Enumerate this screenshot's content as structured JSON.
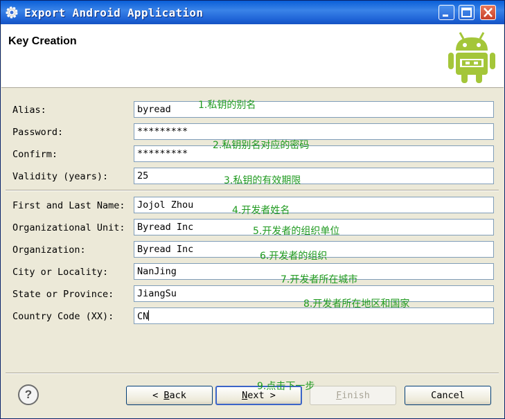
{
  "window": {
    "title": "Export Android Application"
  },
  "header": {
    "title": "Key Creation"
  },
  "form": {
    "alias": {
      "label": "Alias:",
      "value": "byread"
    },
    "password": {
      "label": "Password:",
      "value": "*********"
    },
    "confirm": {
      "label": "Confirm:",
      "value": "*********"
    },
    "validity": {
      "label": "Validity (years):",
      "value": "25"
    },
    "name": {
      "label": "First and Last Name:",
      "value": "Jojol Zhou"
    },
    "org_unit": {
      "label": "Organizational Unit:",
      "value": "Byread Inc"
    },
    "organization": {
      "label": "Organization:",
      "value": "Byread Inc"
    },
    "city": {
      "label": "City or Locality:",
      "value": "NanJing"
    },
    "state": {
      "label": "State or Province:",
      "value": "JiangSu"
    },
    "country": {
      "label": "Country Code (XX):",
      "value": "CN"
    }
  },
  "annotations": {
    "n1": "1.私钥的别名",
    "n2": "2.私钥别名对应的密码",
    "n3": "3.私钥的有效期限",
    "n4": "4.开发者姓名",
    "n5": "5.开发者的组织单位",
    "n6": "6.开发者的组织",
    "n7": "7.开发者所在城市",
    "n8": "8.开发者所在地区和国家",
    "n9": "9.点击下一步"
  },
  "buttons": {
    "help": "?",
    "back_arrow": "<",
    "back_mnemonic": "B",
    "back_rest": "ack",
    "next_mnemonic": "N",
    "next_rest": "ext",
    "next_arrow": ">",
    "finish_mnemonic": "F",
    "finish_rest": "inish",
    "cancel": "Cancel"
  },
  "colors": {
    "annotation": "#1f9a1f",
    "titlebar": "#0a5fd8",
    "android_green": "#a4c639"
  }
}
